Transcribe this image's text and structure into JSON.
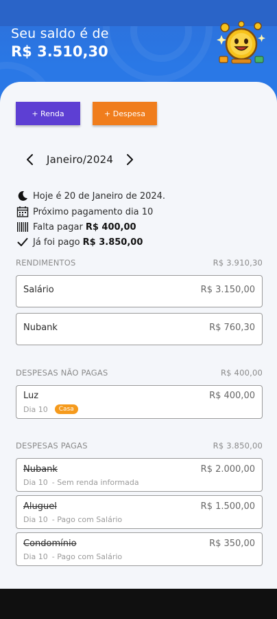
{
  "header": {
    "balance_label": "Seu saldo é de",
    "balance_value": "R$ 3.510,30",
    "mascot_icon": "smiling-coin-mascot-icon"
  },
  "actions": {
    "income_label": "+ Renda",
    "expense_label": "+ Despesa"
  },
  "month_nav": {
    "prev_icon": "chevron-left-icon",
    "label": "Janeiro/2024",
    "next_icon": "chevron-right-icon"
  },
  "info": {
    "today": "Hoje é 20 de Janeiro de 2024.",
    "next_payment": "Próximo pagamento dia 10",
    "remaining_label": "Falta pagar",
    "remaining_value": "R$ 400,00",
    "paid_label": "Já foi pago",
    "paid_value": "R$ 3.850,00"
  },
  "income": {
    "title": "RENDIMENTOS",
    "total": "R$ 3.910,30",
    "items": [
      {
        "name": "Salário",
        "amount": "R$ 3.150,00"
      },
      {
        "name": "Nubank",
        "amount": "R$ 760,30"
      }
    ]
  },
  "unpaid": {
    "title": "DESPESAS NÃO PAGAS",
    "total": "R$ 400,00",
    "items": [
      {
        "name": "Luz",
        "amount": "R$ 400,00",
        "day": "Dia 10",
        "tag": "Casa"
      }
    ]
  },
  "paid": {
    "title": "DESPESAS PAGAS",
    "total": "R$ 3.850,00",
    "items": [
      {
        "name": "Nubank",
        "amount": "R$ 2.000,00",
        "day": "Dia 10",
        "note": "- Sem renda informada"
      },
      {
        "name": "Aluguel",
        "amount": "R$ 1.500,00",
        "day": "Dia 10",
        "note": "- Pago com Salário"
      },
      {
        "name": "Condomínio",
        "amount": "R$ 350,00",
        "day": "Dia 10",
        "note": "- Pago com Salário"
      }
    ]
  },
  "colors": {
    "header_blue": "#2a78e6",
    "income_button": "#5d3fd3",
    "expense_button": "#f07d1c",
    "tag_orange": "#f59a1c"
  }
}
